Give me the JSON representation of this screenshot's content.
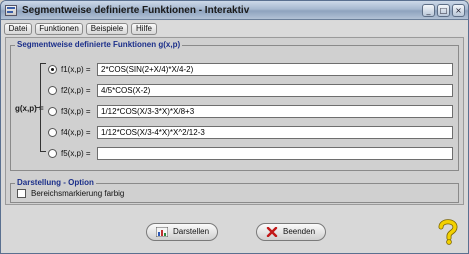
{
  "window": {
    "title": "Segmentweise definierte Funktionen - Interaktiv",
    "controls": {
      "minimize": "_",
      "maximize": "□",
      "close": "×"
    }
  },
  "menu": [
    "Datei",
    "Funktionen",
    "Beispiele",
    "Hilfe"
  ],
  "functions_group": {
    "title": "Segmentweise definierte Funktionen g(x,p)",
    "g_label": "g(x,p) =",
    "rows": [
      {
        "label": "f1(x,p) =",
        "value": "2*COS(SIN(2+X/4)*X/4-2)",
        "selected": true
      },
      {
        "label": "f2(x,p) =",
        "value": "4/5*COS(X-2)",
        "selected": false
      },
      {
        "label": "f3(x,p) =",
        "value": "1/12*COS(X/3-3*X)*X/8+3",
        "selected": false
      },
      {
        "label": "f4(x,p) =",
        "value": "1/12*COS(X/3-4*X)*X^2/12-3",
        "selected": false
      },
      {
        "label": "f5(x,p) =",
        "value": "",
        "selected": false
      }
    ]
  },
  "display_group": {
    "title": "Darstellung - Option",
    "checkbox_label": "Bereichsmarkierung farbig",
    "checked": false
  },
  "buttons": {
    "draw": "Darstellen",
    "quit": "Beenden"
  },
  "colors": {
    "group_title": "#1b2f8a",
    "help_icon": "#e8c800"
  }
}
